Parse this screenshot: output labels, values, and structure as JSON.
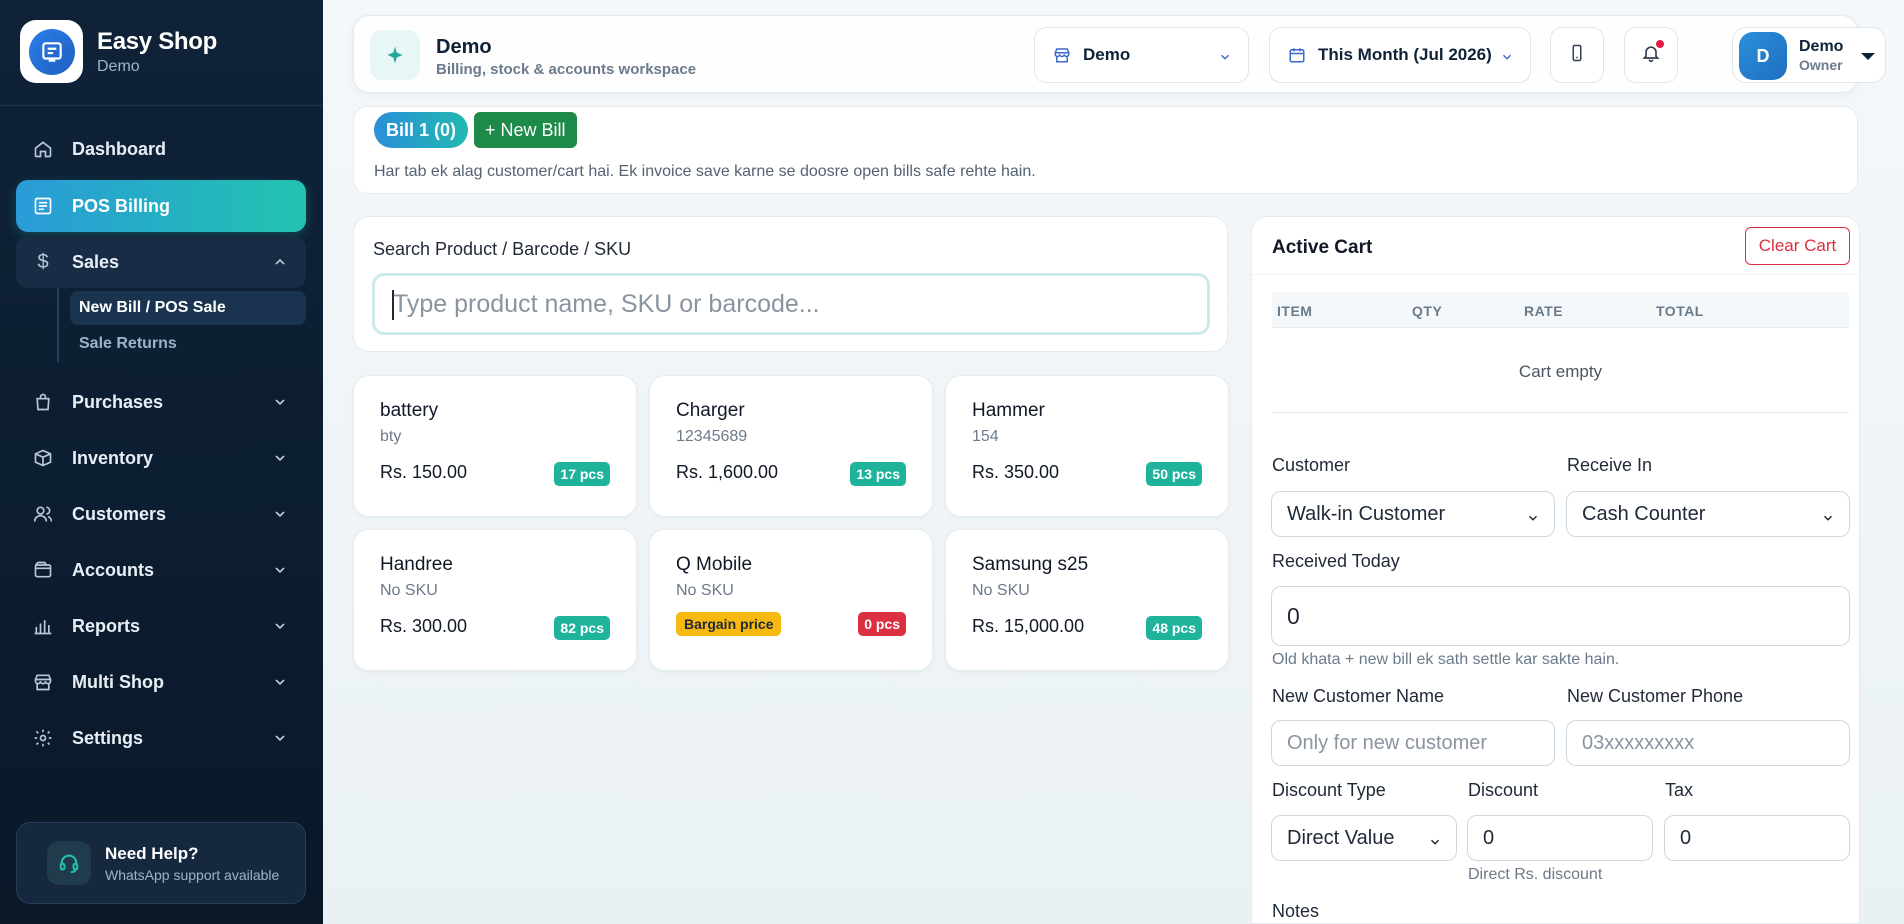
{
  "brand": {
    "title": "Easy Shop",
    "subtitle": "Demo"
  },
  "sidebar": {
    "items": [
      {
        "label": "Dashboard",
        "icon": "home-icon"
      },
      {
        "label": "POS Billing",
        "icon": "receipt-icon"
      },
      {
        "label": "Sales",
        "icon": "dollar-icon"
      },
      {
        "label": "Purchases",
        "icon": "bag-icon"
      },
      {
        "label": "Inventory",
        "icon": "box-icon"
      },
      {
        "label": "Customers",
        "icon": "users-icon"
      },
      {
        "label": "Accounts",
        "icon": "wallet-icon"
      },
      {
        "label": "Reports",
        "icon": "bar-chart-icon"
      },
      {
        "label": "Multi Shop",
        "icon": "store-icon"
      },
      {
        "label": "Settings",
        "icon": "gear-icon"
      }
    ],
    "sales_sub": [
      {
        "label": "New Bill / POS Sale"
      },
      {
        "label": "Sale Returns"
      }
    ],
    "help": {
      "title": "Need Help?",
      "subtitle": "WhatsApp support available"
    }
  },
  "topbar": {
    "title": "Demo",
    "subtitle": "Billing, stock & accounts workspace",
    "shop_select": "Demo",
    "period_select": "This Month (Jul 2026)",
    "user": {
      "initial": "D",
      "name": "Demo",
      "role": "Owner"
    }
  },
  "bills": {
    "active_tab": "Bill 1 (0)",
    "new_bill": "+ New Bill",
    "note": "Har tab ek alag customer/cart hai. Ek invoice save karne se doosre open bills safe rehte hain."
  },
  "search": {
    "label": "Search Product / Barcode / SKU",
    "placeholder": "Type product name, SKU or barcode..."
  },
  "products": [
    {
      "name": "battery",
      "sku": "bty",
      "price": "Rs. 150.00",
      "stock": "17 pcs"
    },
    {
      "name": "Charger",
      "sku": "12345689",
      "price": "Rs. 1,600.00",
      "stock": "13 pcs"
    },
    {
      "name": "Hammer",
      "sku": "154",
      "price": "Rs. 350.00",
      "stock": "50 pcs"
    },
    {
      "name": "Handree",
      "sku": "No SKU",
      "price": "Rs. 300.00",
      "stock": "82 pcs"
    },
    {
      "name": "Q Mobile",
      "sku": "No SKU",
      "badge": "Bargain price",
      "stock": "0 pcs"
    },
    {
      "name": "Samsung s25",
      "sku": "No SKU",
      "price": "Rs. 15,000.00",
      "stock": "48 pcs"
    }
  ],
  "cart": {
    "title": "Active Cart",
    "clear": "Clear Cart",
    "columns": [
      "ITEM",
      "QTY",
      "RATE",
      "TOTAL"
    ],
    "empty": "Cart empty",
    "customer_label": "Customer",
    "customer_value": "Walk-in Customer",
    "receive_label": "Receive In",
    "receive_value": "Cash Counter",
    "received_label": "Received Today",
    "received_value": "0",
    "received_hint": "Old khata + new bill ek sath settle kar sakte hain.",
    "new_name_label": "New Customer Name",
    "new_name_placeholder": "Only for new customer",
    "new_phone_label": "New Customer Phone",
    "new_phone_placeholder": "03xxxxxxxxx",
    "discount_type_label": "Discount Type",
    "discount_type_value": "Direct Value",
    "discount_label": "Discount",
    "discount_value": "0",
    "discount_hint": "Direct Rs. discount",
    "tax_label": "Tax",
    "tax_value": "0",
    "notes_label": "Notes"
  },
  "colors": {
    "accent": "#22c3b0",
    "primary": "#2a8fd8",
    "sidebar": "#0f2238",
    "danger": "#dc2f3f",
    "success": "#1e8a4a"
  }
}
